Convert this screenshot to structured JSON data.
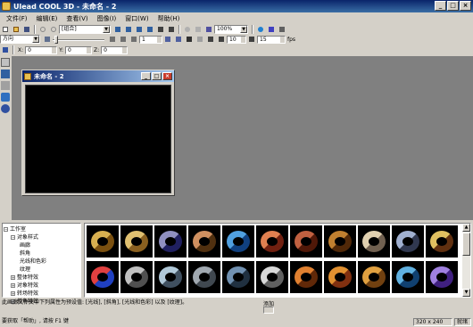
{
  "window": {
    "title": "Ulead COOL 3D - 未命名 - 2"
  },
  "menu": [
    "文件(F)",
    "编辑(E)",
    "查看(V)",
    "图像(I)",
    "窗口(W)",
    "帮助(H)"
  ],
  "toolbar1": {
    "group_combo": "[组合]",
    "zoom_combo": "100%"
  },
  "toolbar2": {
    "direction_combo": "方向",
    "field1": "1",
    "frame_field": "10",
    "fps_field": "15",
    "fps_label": "fps"
  },
  "toolbar3": {
    "x_label": "X:",
    "x_value": "0",
    "y_label": "Y:",
    "y_value": "0",
    "z_label": "Z:",
    "z_value": "0"
  },
  "child_window": {
    "title": "未命名 - 2"
  },
  "tree": {
    "items": [
      {
        "label": "工作室",
        "level": 0,
        "toggle": "−"
      },
      {
        "label": "对象样式",
        "level": 1,
        "toggle": "−"
      },
      {
        "label": "画廊",
        "level": 2
      },
      {
        "label": "斜角",
        "level": 2
      },
      {
        "label": "光线和色彩",
        "level": 2
      },
      {
        "label": "纹理",
        "level": 2
      },
      {
        "label": "整体特效",
        "level": 1,
        "toggle": "+"
      },
      {
        "label": "对象特效",
        "level": 1,
        "toggle": "+"
      },
      {
        "label": "转场特效",
        "level": 1,
        "toggle": "+"
      },
      {
        "label": "斜角特效",
        "level": 1,
        "toggle": "+"
      }
    ]
  },
  "gallery": {
    "thumbnails": [
      {
        "colors": [
          "#d8b050",
          "#7a5010"
        ]
      },
      {
        "colors": [
          "#e0c070",
          "#8a6020"
        ]
      },
      {
        "colors": [
          "#9090c0",
          "#202060"
        ]
      },
      {
        "colors": [
          "#d09060",
          "#503010"
        ]
      },
      {
        "colors": [
          "#50a0e0",
          "#104080"
        ]
      },
      {
        "colors": [
          "#e08050",
          "#702010"
        ]
      },
      {
        "colors": [
          "#c06040",
          "#501808"
        ]
      },
      {
        "colors": [
          "#c08030",
          "#502808"
        ]
      },
      {
        "colors": [
          "#e0d0b0",
          "#706050"
        ]
      },
      {
        "colors": [
          "#a0b0d0",
          "#303850"
        ]
      },
      {
        "colors": [
          "#e0c060",
          "#603010"
        ]
      },
      {
        "colors": [
          "#e04040",
          "#2040c0"
        ]
      },
      {
        "colors": [
          "#c0c0c0",
          "#505050"
        ]
      },
      {
        "colors": [
          "#b0c8d8",
          "#405060"
        ]
      },
      {
        "colors": [
          "#a0a8b0",
          "#404850"
        ]
      },
      {
        "colors": [
          "#7090b0",
          "#203040"
        ]
      },
      {
        "colors": [
          "#d8d8d8",
          "#606060"
        ]
      },
      {
        "colors": [
          "#e08030",
          "#602808"
        ]
      },
      {
        "colors": [
          "#e09030",
          "#803010"
        ]
      },
      {
        "colors": [
          "#e0a040",
          "#704010"
        ]
      },
      {
        "colors": [
          "#60b0e0",
          "#104070"
        ]
      },
      {
        "colors": [
          "#a080e0",
          "#402080"
        ]
      }
    ]
  },
  "description": "此画廊文件夹中下列属性为预设值: [光线], [斜角], [光线和色彩] 以及 [纹理]。",
  "add_label": "添加",
  "status": {
    "help": "要获取「帮助」, 请按 F1 键",
    "size": "320 x 240",
    "mode": "就绪"
  }
}
